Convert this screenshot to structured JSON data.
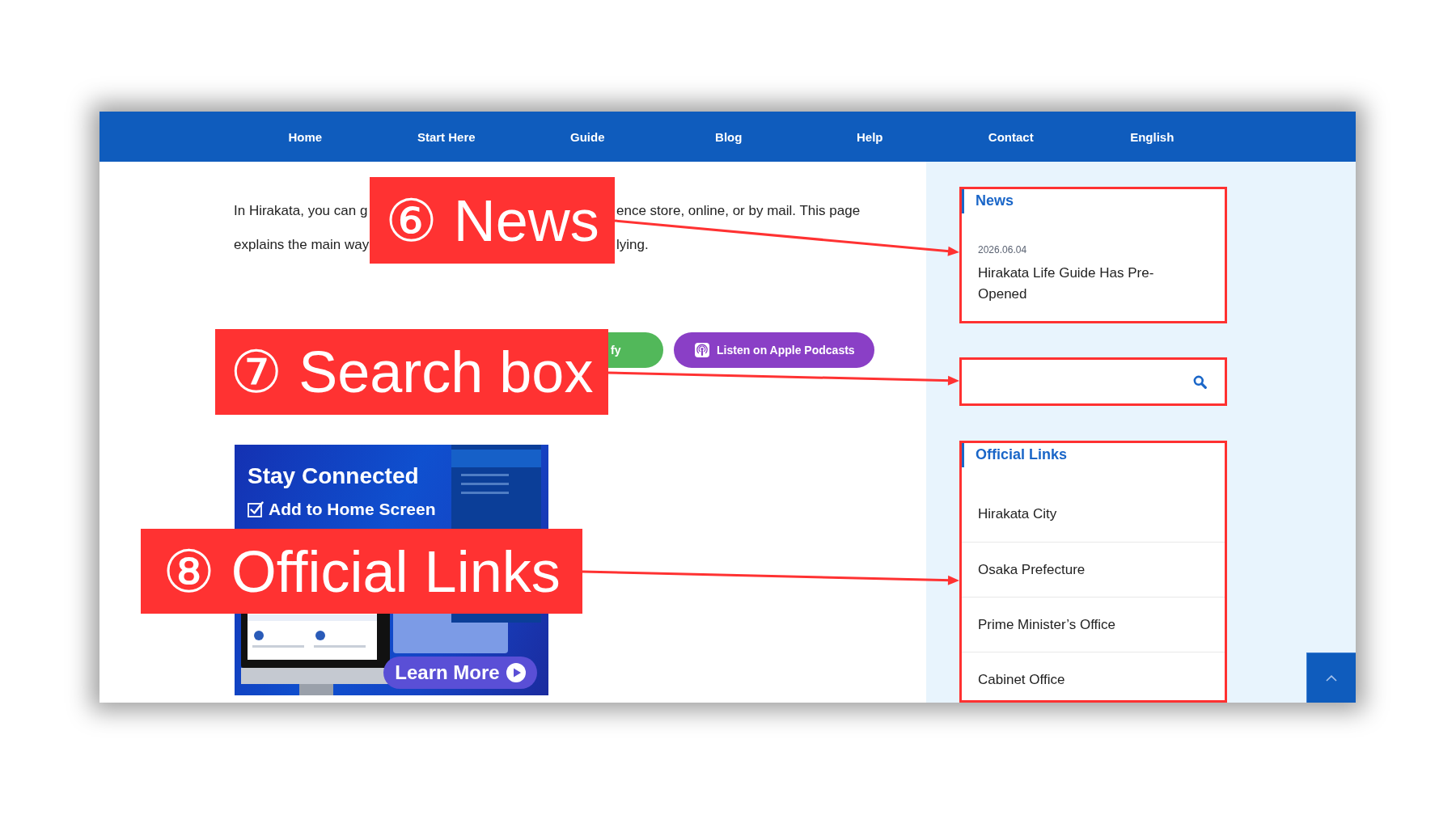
{
  "nav": {
    "items": [
      "Home",
      "Start Here",
      "Guide",
      "Blog",
      "Help",
      "Contact",
      "English"
    ]
  },
  "intro": {
    "lines": [
      {
        "start": "In Hirakata, you can g",
        "end": "ence store, online, or by mail. This page"
      },
      {
        "start": "explains the main way",
        "end": "lying."
      }
    ]
  },
  "listen_buttons": [
    {
      "kind": "plain",
      "label": "fy",
      "color": "#52b85a"
    },
    {
      "kind": "podcast",
      "label": "Listen on Apple Podcasts",
      "color": "#8a3fc6"
    }
  ],
  "promo_banner": {
    "title": "Stay Connected",
    "checklist_item": "Add to Home Screen",
    "button": "Learn More"
  },
  "sidebar": {
    "widgets": [
      {
        "kind": "news",
        "heading": "News",
        "items": [
          {
            "date": "2026.06.04",
            "title": "Hirakata Life Guide Has Pre-Opened"
          }
        ]
      },
      {
        "kind": "search"
      },
      {
        "kind": "links",
        "heading": "Official Links",
        "items": [
          "Hirakata City",
          "Osaka Prefecture",
          "Prime Minister’s Office",
          "Cabinet Office"
        ]
      }
    ]
  },
  "annotations": [
    {
      "label": "⑥ News"
    },
    {
      "label": "⑦ Search box"
    },
    {
      "label": "⑧ Official Links"
    }
  ]
}
